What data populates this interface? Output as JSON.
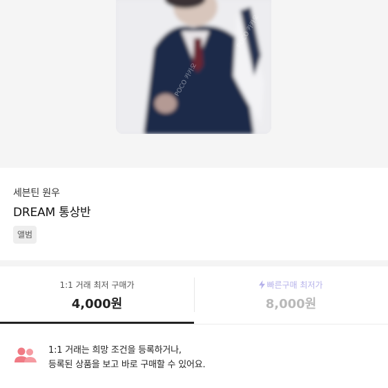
{
  "product": {
    "artist": "세븐틴 원우",
    "title": "DREAM 통상반",
    "tag": "앨범",
    "image_watermark": "POCO 카카오"
  },
  "price_tabs": [
    {
      "label": "1:1 거래 최저 구매가",
      "price": "4,000원",
      "active": true
    },
    {
      "label": "빠른구매 최저가",
      "price": "8,000원",
      "active": false,
      "icon": "lightning-icon"
    }
  ],
  "notice": {
    "line1": "1:1 거래는 희망 조건을 등록하거나,",
    "line2": "등록된 상품을 보고 바로 구매할 수 있어요.",
    "icon": "users-icon"
  },
  "colors": {
    "accent_purple": "#b6b2ea",
    "notice_icon": "#f07a84",
    "active_tab": "#222222"
  }
}
